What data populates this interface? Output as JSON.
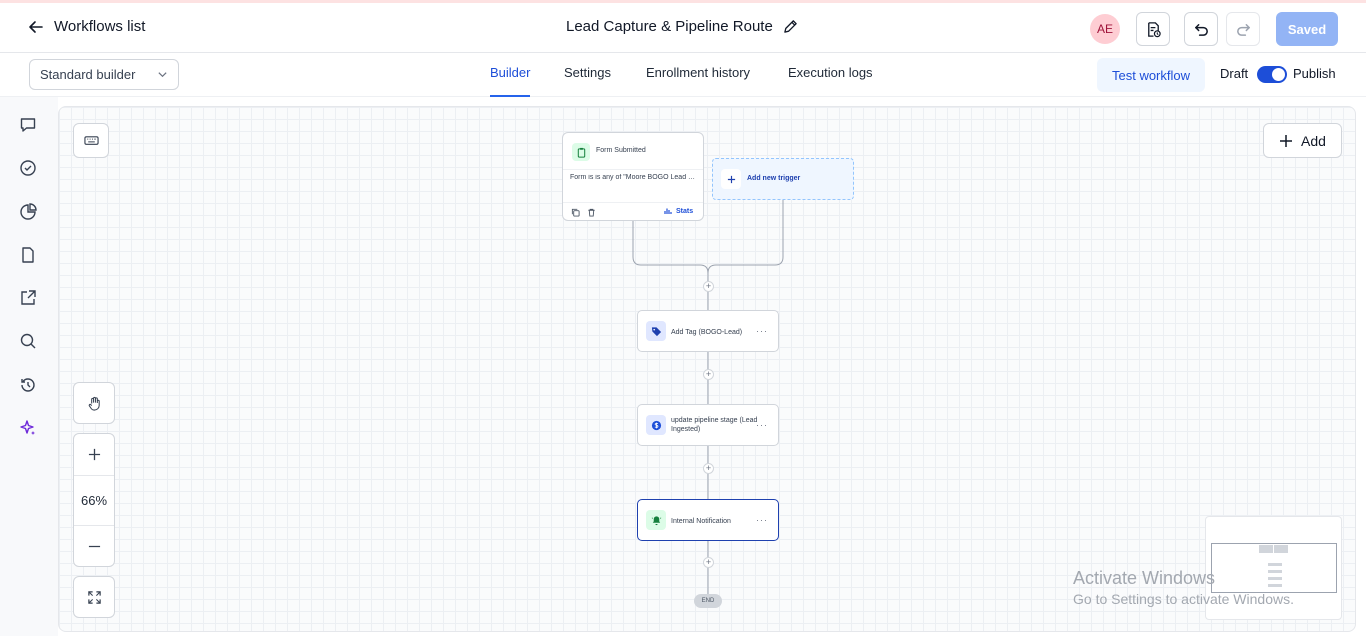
{
  "header": {
    "back_label": "Workflows list",
    "workflow_title": "Lead Capture & Pipeline Route",
    "avatar_initials": "AE",
    "saved_label": "Saved"
  },
  "subheader": {
    "builder_select": "Standard builder",
    "tabs": [
      {
        "label": "Builder",
        "active": true
      },
      {
        "label": "Settings",
        "active": false
      },
      {
        "label": "Enrollment history",
        "active": false
      },
      {
        "label": "Execution logs",
        "active": false
      }
    ],
    "test_workflow_label": "Test workflow",
    "draft_label": "Draft",
    "publish_label": "Publish",
    "publish_toggle_on": true
  },
  "rail_icons": [
    "chat-icon",
    "check-circle-icon",
    "pie-chart-icon",
    "document-icon",
    "external-link-icon",
    "search-icon",
    "history-icon",
    "sparkle-icon"
  ],
  "canvas": {
    "add_label": "Add",
    "zoom_level": "66%",
    "trigger": {
      "title": "Form Submitted",
      "description": "Form is is any of \"Moore BOGO Lead Form\"",
      "stats_label": "Stats"
    },
    "add_trigger_label": "Add new trigger",
    "steps": [
      {
        "label": "Add Tag (BOGO-Lead)",
        "icon": "tag-icon",
        "icon_bg": "#e0e7ff",
        "icon_color": "#1e40af"
      },
      {
        "label": "update pipeline stage (Lead Ingested)",
        "icon": "dollar-icon",
        "icon_bg": "#e0e7ff",
        "icon_color": "#1d4ed8"
      },
      {
        "label": "Internal Notification",
        "icon": "bell-icon",
        "icon_bg": "#dcfce7",
        "icon_color": "#15803d"
      }
    ],
    "end_label": "END"
  },
  "watermark": {
    "line1": "Activate Windows",
    "line2": "Go to Settings to activate Windows."
  },
  "colors": {
    "accent": "#2563eb",
    "saved_button": "#93b4f5"
  }
}
